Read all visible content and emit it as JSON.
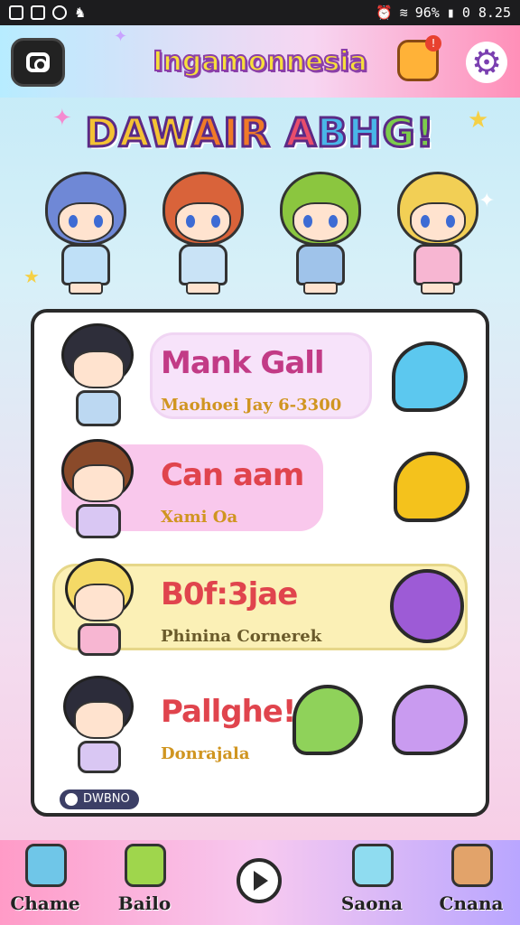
{
  "status_bar": {
    "battery": "96%",
    "time": "0 8.25"
  },
  "header": {
    "app_title": "Ingamonnesia"
  },
  "banner": {
    "parts": [
      "DAW",
      "AIR",
      " A",
      "BH",
      "G!"
    ]
  },
  "contacts": [
    {
      "name": "Mank Gall",
      "subtitle": "Maohoei Jay 6-3300",
      "name_color": "#c23b86",
      "pill_color": "#f7e3fa"
    },
    {
      "name": "Can aam",
      "subtitle": "Xami Oa",
      "name_color": "#e0444d",
      "pill_color": "#f9c8ec"
    },
    {
      "name": "B0f:3jae",
      "subtitle": "Phinina Cornerek",
      "name_color": "#e0444d",
      "pill_color": "#fbf0b6"
    },
    {
      "name": "Pallghe!",
      "subtitle": "Donrajala",
      "name_color": "#e0444d",
      "pill_color": "#ffffff"
    }
  ],
  "online_chip": "DWBNO",
  "bottom_nav": [
    {
      "label": "Chame",
      "icon": "stack-icon"
    },
    {
      "label": "Bailo",
      "icon": "gift-icon"
    },
    {
      "label": "Saona",
      "icon": "cup-icon"
    },
    {
      "label": "Cnana",
      "icon": "bell-icon"
    }
  ]
}
